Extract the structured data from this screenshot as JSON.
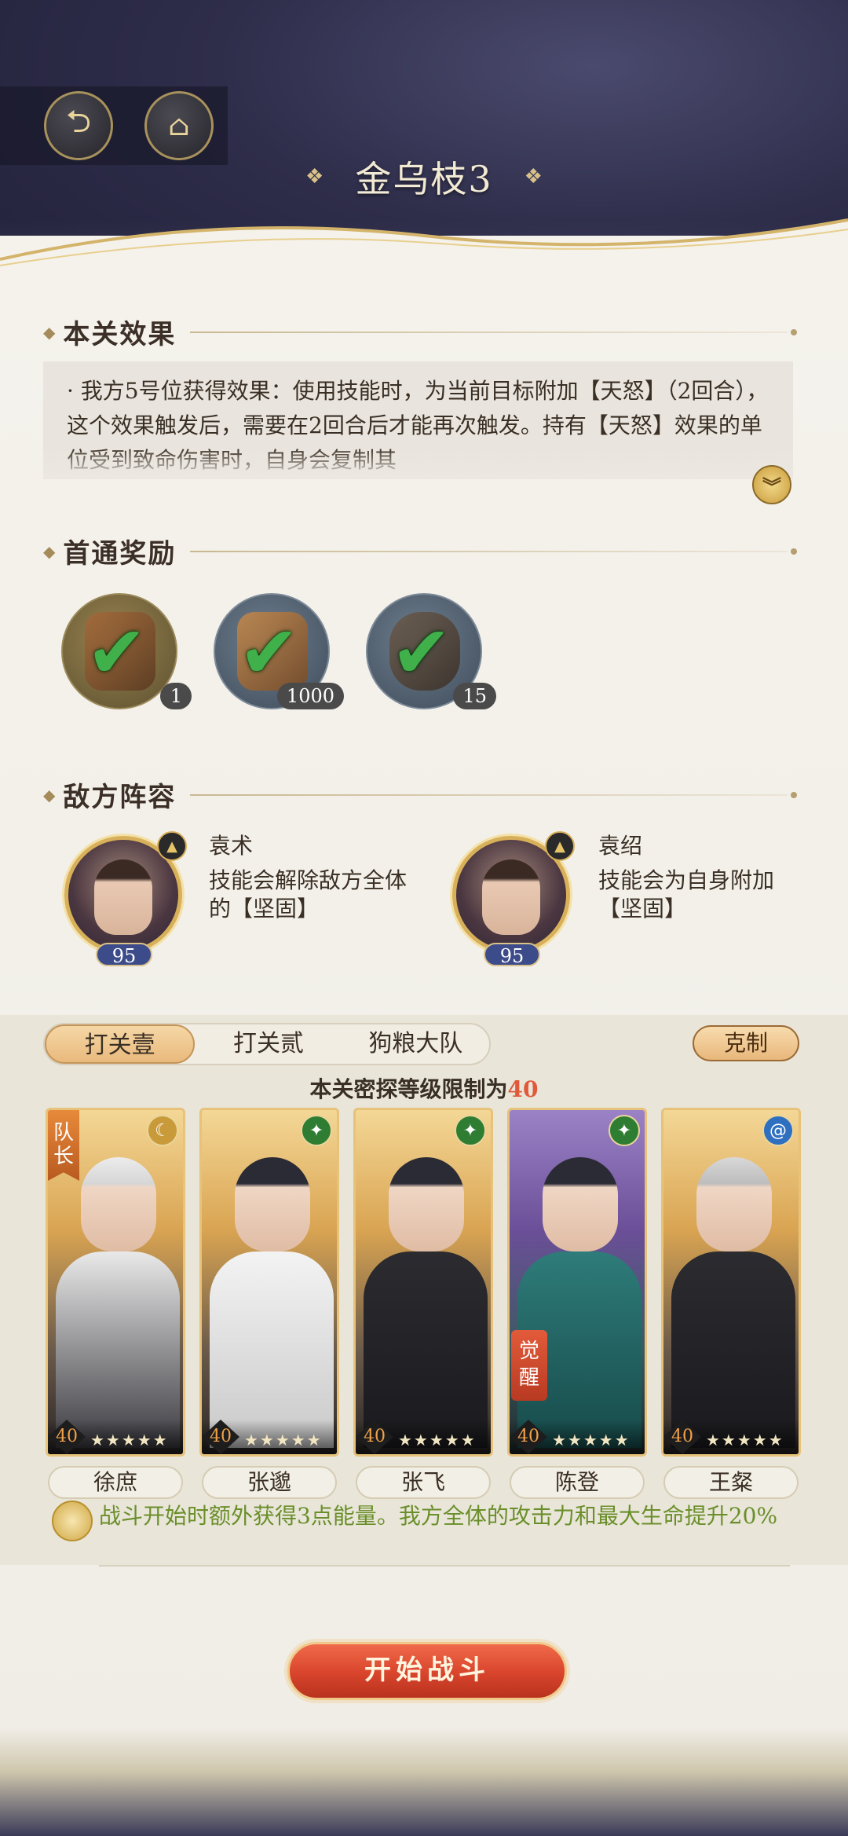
{
  "header": {
    "title": "金乌枝3",
    "back_icon": "back-arrow-icon",
    "home_icon": "pavilion-icon"
  },
  "stage_effect": {
    "heading": "本关效果",
    "text": "· 我方5号位获得效果：使用技能时，为当前目标附加【天怒】（2回合），这个效果触发后，需要在2回合后才能再次触发。持有【天怒】效果的单位受到致命伤害时，自身会复制其"
  },
  "first_clear_reward": {
    "heading": "首通奖励",
    "items": [
      {
        "name": "token-reward",
        "count": "1",
        "claimed": true
      },
      {
        "name": "jade-reward",
        "count": "1000",
        "claimed": true
      },
      {
        "name": "jar-reward",
        "count": "15",
        "claimed": true
      }
    ]
  },
  "enemy_lineup": {
    "heading": "敌方阵容",
    "enemies": [
      {
        "name": "袁术",
        "level": "95",
        "desc": "技能会解除敌方全体的【坚固】"
      },
      {
        "name": "袁绍",
        "level": "95",
        "desc": "技能会为自身附加【坚固】"
      }
    ]
  },
  "team": {
    "tabs": [
      "打关壹",
      "打关贰",
      "狗粮大队"
    ],
    "active_tab": 0,
    "counter_button": "克制",
    "limit_prefix": "本关密探等级限制为",
    "limit_value": "40",
    "captain_label": "队长",
    "awaken_label": "觉醒",
    "members": [
      {
        "name": "徐庶",
        "level": "40",
        "stars": "★★★★★",
        "element": "moon"
      },
      {
        "name": "张邈",
        "level": "40",
        "stars": "★★★★★",
        "element": "wind"
      },
      {
        "name": "张飞",
        "level": "40",
        "stars": "★★★★★",
        "element": "wind"
      },
      {
        "name": "陈登",
        "level": "40",
        "stars": "★★★★★",
        "element": "wind"
      },
      {
        "name": "王粲",
        "level": "40",
        "stars": "★★★★★",
        "element": "water"
      }
    ],
    "bonus": "战斗开始时额外获得3点能量。我方全体的攻击力和最大生命提升20%"
  },
  "start_button": "开始战斗"
}
